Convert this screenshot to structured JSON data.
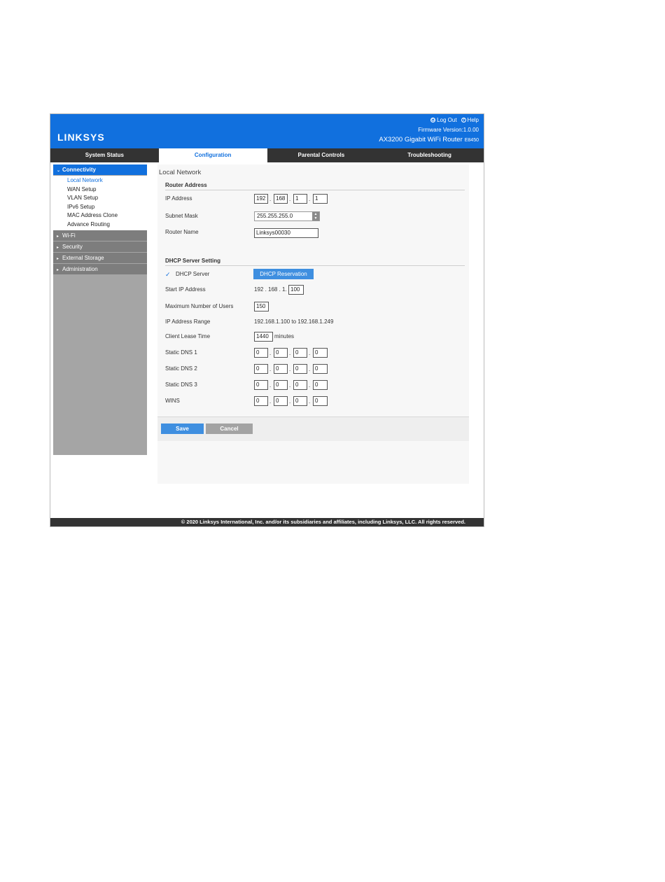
{
  "header": {
    "logo": "LINKSYS",
    "logout": "Log Out",
    "help": "Help",
    "firmware": "Firmware Version:1.0.00",
    "model": "AX3200 Gigabit WiFi Router",
    "model_code": "E8450"
  },
  "tabs": [
    "System Status",
    "Configuration",
    "Parental Controls",
    "Troubleshooting"
  ],
  "active_tab": "Configuration",
  "sidebar": {
    "sections": [
      {
        "label": "Connectivity",
        "expanded": true,
        "items": [
          "Local Network",
          "WAN Setup",
          "VLAN Setup",
          "IPv6 Setup",
          "MAC Address Clone",
          "Advance Routing"
        ]
      },
      {
        "label": "Wi-Fi"
      },
      {
        "label": "Security"
      },
      {
        "label": "External Storage"
      },
      {
        "label": "Administration"
      }
    ]
  },
  "page": {
    "title": "Local Network",
    "router_address": {
      "heading": "Router Address",
      "ip_label": "IP Address",
      "ip": [
        "192",
        "168",
        "1",
        "1"
      ],
      "mask_label": "Subnet Mask",
      "mask": "255.255.255.0",
      "name_label": "Router Name",
      "name": "Linksys00030"
    },
    "dhcp": {
      "heading": "DHCP Server Setting",
      "server_label": "DHCP Server",
      "reservation_button": "DHCP Reservation",
      "start_label": "Start IP Address",
      "start_prefix": "192 . 168 . 1.",
      "start_last": "100",
      "max_label": "Maximum Number of Users",
      "max_users": "150",
      "range_label": "IP Address Range",
      "range": "192.168.1.100 to 192.168.1.249",
      "lease_label": "Client Lease Time",
      "lease": "1440",
      "lease_unit": "minutes",
      "dns1_label": "Static DNS 1",
      "dns1": [
        "0",
        "0",
        "0",
        "0"
      ],
      "dns2_label": "Static DNS 2",
      "dns2": [
        "0",
        "0",
        "0",
        "0"
      ],
      "dns3_label": "Static DNS 3",
      "dns3": [
        "0",
        "0",
        "0",
        "0"
      ],
      "wins_label": "WINS",
      "wins": [
        "0",
        "0",
        "0",
        "0"
      ]
    },
    "save": "Save",
    "cancel": "Cancel"
  },
  "footer": "© 2020 Linksys International, Inc. and/or its subsidiaries and affiliates, including Linksys, LLC. All rights reserved.",
  "colors": {
    "brand": "#1170de",
    "dark_bar": "#333333",
    "sidebar_gray": "#a5a5a5",
    "cancel_gray": "#a3a3a3"
  }
}
